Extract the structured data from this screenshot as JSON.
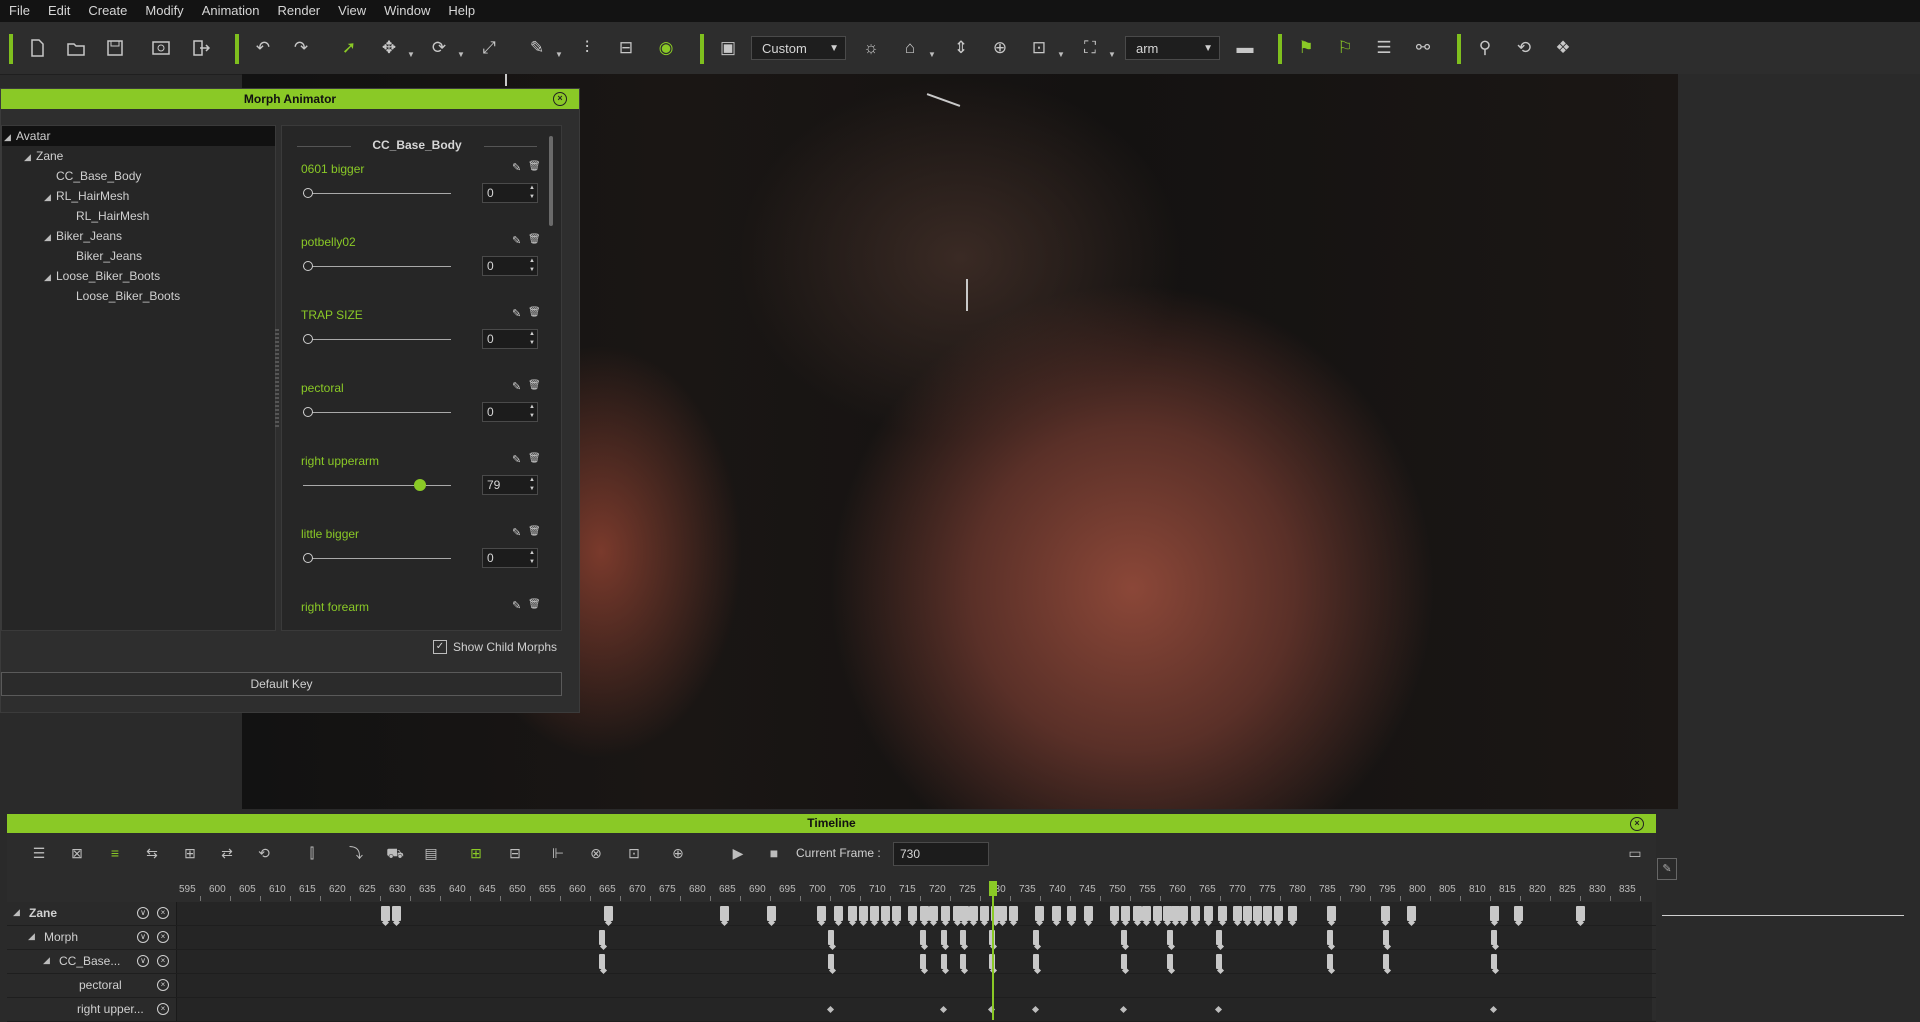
{
  "menu": [
    "File",
    "Edit",
    "Create",
    "Modify",
    "Animation",
    "Render",
    "View",
    "Window",
    "Help"
  ],
  "toolbar": {
    "camera_dropdown": "Custom",
    "pose_dropdown": "arm"
  },
  "colors": {
    "accent": "#8ac926",
    "background": "#2a2a2a",
    "menubar": "#131313"
  },
  "morph_animator": {
    "title": "Morph Animator",
    "tree": [
      {
        "label": "Avatar",
        "depth": 0,
        "expanded": true,
        "selected": true
      },
      {
        "label": "Zane",
        "depth": 1,
        "expanded": true
      },
      {
        "label": "CC_Base_Body",
        "depth": 2
      },
      {
        "label": "RL_HairMesh",
        "depth": 2,
        "expanded": true
      },
      {
        "label": "RL_HairMesh",
        "depth": 3
      },
      {
        "label": "Biker_Jeans",
        "depth": 2,
        "expanded": true
      },
      {
        "label": "Biker_Jeans",
        "depth": 3
      },
      {
        "label": "Loose_Biker_Boots",
        "depth": 2,
        "expanded": true
      },
      {
        "label": "Loose_Biker_Boots",
        "depth": 3
      }
    ],
    "group_header": "CC_Base_Body",
    "morphs": [
      {
        "name": "0601 bigger",
        "value": "0",
        "slider": 0
      },
      {
        "name": "potbelly02",
        "value": "0",
        "slider": 0
      },
      {
        "name": "TRAP SIZE",
        "value": "0",
        "slider": 0
      },
      {
        "name": "pectoral",
        "value": "0",
        "slider": 0
      },
      {
        "name": "right upperarm",
        "value": "79",
        "slider": 0.79
      },
      {
        "name": "little bigger",
        "value": "0",
        "slider": 0
      },
      {
        "name": "right forearm",
        "value": "",
        "slider": null
      }
    ],
    "show_child_morphs": "Show Child Morphs",
    "default_key": "Default Key"
  },
  "timeline": {
    "title": "Timeline",
    "current_frame_label": "Current Frame :",
    "current_frame": "730",
    "ruler": [
      "595",
      "600",
      "605",
      "610",
      "615",
      "620",
      "625",
      "630",
      "635",
      "640",
      "645",
      "650",
      "655",
      "660",
      "665",
      "670",
      "675",
      "680",
      "685",
      "690",
      "695",
      "700",
      "705",
      "710",
      "715",
      "720",
      "725",
      "730",
      "735",
      "740",
      "745",
      "750",
      "755",
      "760",
      "765",
      "770",
      "775",
      "780",
      "785",
      "790",
      "795",
      "800",
      "805",
      "810",
      "815",
      "820",
      "825",
      "830",
      "835"
    ],
    "tracks": [
      {
        "label": "Zane",
        "indent": 0,
        "bold": true
      },
      {
        "label": "Morph",
        "indent": 1
      },
      {
        "label": "CC_Base...",
        "indent": 2
      },
      {
        "label": "pectoral",
        "indent": 3
      },
      {
        "label": "right upper...",
        "indent": 3
      }
    ]
  }
}
